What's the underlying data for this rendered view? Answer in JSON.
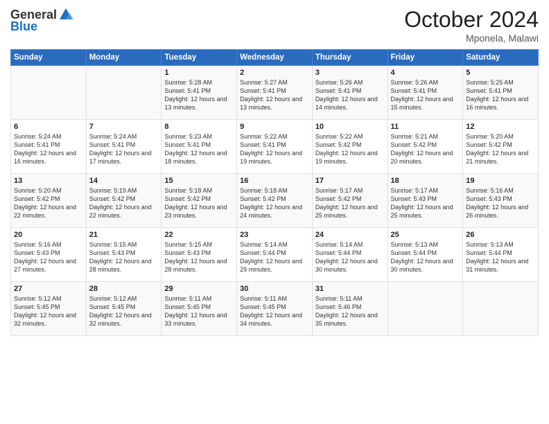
{
  "logo": {
    "general": "General",
    "blue": "Blue"
  },
  "header": {
    "month": "October 2024",
    "location": "Mponela, Malawi"
  },
  "weekdays": [
    "Sunday",
    "Monday",
    "Tuesday",
    "Wednesday",
    "Thursday",
    "Friday",
    "Saturday"
  ],
  "rows": [
    [
      {
        "day": "",
        "sunrise": "",
        "sunset": "",
        "daylight": ""
      },
      {
        "day": "",
        "sunrise": "",
        "sunset": "",
        "daylight": ""
      },
      {
        "day": "1",
        "sunrise": "Sunrise: 5:28 AM",
        "sunset": "Sunset: 5:41 PM",
        "daylight": "Daylight: 12 hours and 13 minutes."
      },
      {
        "day": "2",
        "sunrise": "Sunrise: 5:27 AM",
        "sunset": "Sunset: 5:41 PM",
        "daylight": "Daylight: 12 hours and 13 minutes."
      },
      {
        "day": "3",
        "sunrise": "Sunrise: 5:26 AM",
        "sunset": "Sunset: 5:41 PM",
        "daylight": "Daylight: 12 hours and 14 minutes."
      },
      {
        "day": "4",
        "sunrise": "Sunrise: 5:26 AM",
        "sunset": "Sunset: 5:41 PM",
        "daylight": "Daylight: 12 hours and 15 minutes."
      },
      {
        "day": "5",
        "sunrise": "Sunrise: 5:25 AM",
        "sunset": "Sunset: 5:41 PM",
        "daylight": "Daylight: 12 hours and 16 minutes."
      }
    ],
    [
      {
        "day": "6",
        "sunrise": "Sunrise: 5:24 AM",
        "sunset": "Sunset: 5:41 PM",
        "daylight": "Daylight: 12 hours and 16 minutes."
      },
      {
        "day": "7",
        "sunrise": "Sunrise: 5:24 AM",
        "sunset": "Sunset: 5:41 PM",
        "daylight": "Daylight: 12 hours and 17 minutes."
      },
      {
        "day": "8",
        "sunrise": "Sunrise: 5:23 AM",
        "sunset": "Sunset: 5:41 PM",
        "daylight": "Daylight: 12 hours and 18 minutes."
      },
      {
        "day": "9",
        "sunrise": "Sunrise: 5:22 AM",
        "sunset": "Sunset: 5:41 PM",
        "daylight": "Daylight: 12 hours and 19 minutes."
      },
      {
        "day": "10",
        "sunrise": "Sunrise: 5:22 AM",
        "sunset": "Sunset: 5:42 PM",
        "daylight": "Daylight: 12 hours and 19 minutes."
      },
      {
        "day": "11",
        "sunrise": "Sunrise: 5:21 AM",
        "sunset": "Sunset: 5:42 PM",
        "daylight": "Daylight: 12 hours and 20 minutes."
      },
      {
        "day": "12",
        "sunrise": "Sunrise: 5:20 AM",
        "sunset": "Sunset: 5:42 PM",
        "daylight": "Daylight: 12 hours and 21 minutes."
      }
    ],
    [
      {
        "day": "13",
        "sunrise": "Sunrise: 5:20 AM",
        "sunset": "Sunset: 5:42 PM",
        "daylight": "Daylight: 12 hours and 22 minutes."
      },
      {
        "day": "14",
        "sunrise": "Sunrise: 5:19 AM",
        "sunset": "Sunset: 5:42 PM",
        "daylight": "Daylight: 12 hours and 22 minutes."
      },
      {
        "day": "15",
        "sunrise": "Sunrise: 5:18 AM",
        "sunset": "Sunset: 5:42 PM",
        "daylight": "Daylight: 12 hours and 23 minutes."
      },
      {
        "day": "16",
        "sunrise": "Sunrise: 5:18 AM",
        "sunset": "Sunset: 5:42 PM",
        "daylight": "Daylight: 12 hours and 24 minutes."
      },
      {
        "day": "17",
        "sunrise": "Sunrise: 5:17 AM",
        "sunset": "Sunset: 5:42 PM",
        "daylight": "Daylight: 12 hours and 25 minutes."
      },
      {
        "day": "18",
        "sunrise": "Sunrise: 5:17 AM",
        "sunset": "Sunset: 5:43 PM",
        "daylight": "Daylight: 12 hours and 25 minutes."
      },
      {
        "day": "19",
        "sunrise": "Sunrise: 5:16 AM",
        "sunset": "Sunset: 5:43 PM",
        "daylight": "Daylight: 12 hours and 26 minutes."
      }
    ],
    [
      {
        "day": "20",
        "sunrise": "Sunrise: 5:16 AM",
        "sunset": "Sunset: 5:43 PM",
        "daylight": "Daylight: 12 hours and 27 minutes."
      },
      {
        "day": "21",
        "sunrise": "Sunrise: 5:15 AM",
        "sunset": "Sunset: 5:43 PM",
        "daylight": "Daylight: 12 hours and 28 minutes."
      },
      {
        "day": "22",
        "sunrise": "Sunrise: 5:15 AM",
        "sunset": "Sunset: 5:43 PM",
        "daylight": "Daylight: 12 hours and 28 minutes."
      },
      {
        "day": "23",
        "sunrise": "Sunrise: 5:14 AM",
        "sunset": "Sunset: 5:44 PM",
        "daylight": "Daylight: 12 hours and 29 minutes."
      },
      {
        "day": "24",
        "sunrise": "Sunrise: 5:14 AM",
        "sunset": "Sunset: 5:44 PM",
        "daylight": "Daylight: 12 hours and 30 minutes."
      },
      {
        "day": "25",
        "sunrise": "Sunrise: 5:13 AM",
        "sunset": "Sunset: 5:44 PM",
        "daylight": "Daylight: 12 hours and 30 minutes."
      },
      {
        "day": "26",
        "sunrise": "Sunrise: 5:13 AM",
        "sunset": "Sunset: 5:44 PM",
        "daylight": "Daylight: 12 hours and 31 minutes."
      }
    ],
    [
      {
        "day": "27",
        "sunrise": "Sunrise: 5:12 AM",
        "sunset": "Sunset: 5:45 PM",
        "daylight": "Daylight: 12 hours and 32 minutes."
      },
      {
        "day": "28",
        "sunrise": "Sunrise: 5:12 AM",
        "sunset": "Sunset: 5:45 PM",
        "daylight": "Daylight: 12 hours and 32 minutes."
      },
      {
        "day": "29",
        "sunrise": "Sunrise: 5:11 AM",
        "sunset": "Sunset: 5:45 PM",
        "daylight": "Daylight: 12 hours and 33 minutes."
      },
      {
        "day": "30",
        "sunrise": "Sunrise: 5:11 AM",
        "sunset": "Sunset: 5:45 PM",
        "daylight": "Daylight: 12 hours and 34 minutes."
      },
      {
        "day": "31",
        "sunrise": "Sunrise: 5:11 AM",
        "sunset": "Sunset: 5:46 PM",
        "daylight": "Daylight: 12 hours and 35 minutes."
      },
      {
        "day": "",
        "sunrise": "",
        "sunset": "",
        "daylight": ""
      },
      {
        "day": "",
        "sunrise": "",
        "sunset": "",
        "daylight": ""
      }
    ]
  ]
}
